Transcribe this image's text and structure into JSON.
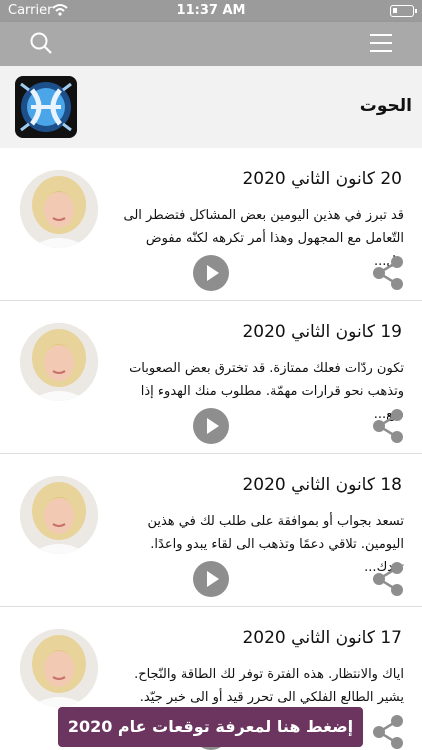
{
  "status_bar": {
    "carrier": "Carrier",
    "time": "11:37 AM"
  },
  "header": {
    "title": "الحوت",
    "logo_icon": "pisces-sign-icon"
  },
  "items": [
    {
      "date": "20 كانون الثاني 2020",
      "text": "قد تبرز في هذين اليومين بعض المشاكل فتضطر الى التّعامل مع المجهول وهذا أمر تكرهه لكنّه مفوض عل..."
    },
    {
      "date": "19 كانون الثاني 2020",
      "text": "تكون ردّات فعلك ممتازة. قد تخترق بعض الصعوبات وتذهب نحو قرارات مهمّة. مطلوب منك الهدوء إذا شع..."
    },
    {
      "date": "18 كانون الثاني 2020",
      "text": "تسعد بجواب أو بموافقة على طلب لك في هذين اليومين. تلاقي دعمًا وتذهب الى لقاء يبدو واعدًا. تعدك..."
    },
    {
      "date": "17 كانون الثاني 2020",
      "text": "اياك والانتظار. هذه الفترة توفر لك الطاقة والنّجاح. يشير الطالع الفلكي الى تحرر قيد أو الى خبر جيّد."
    }
  ],
  "cta_label": "إضغط هنا لمعرفة توقعات عام 2020",
  "colors": {
    "cta": "#6b355f",
    "navbar": "#a9a9a9",
    "play": "#8e8e8e"
  }
}
